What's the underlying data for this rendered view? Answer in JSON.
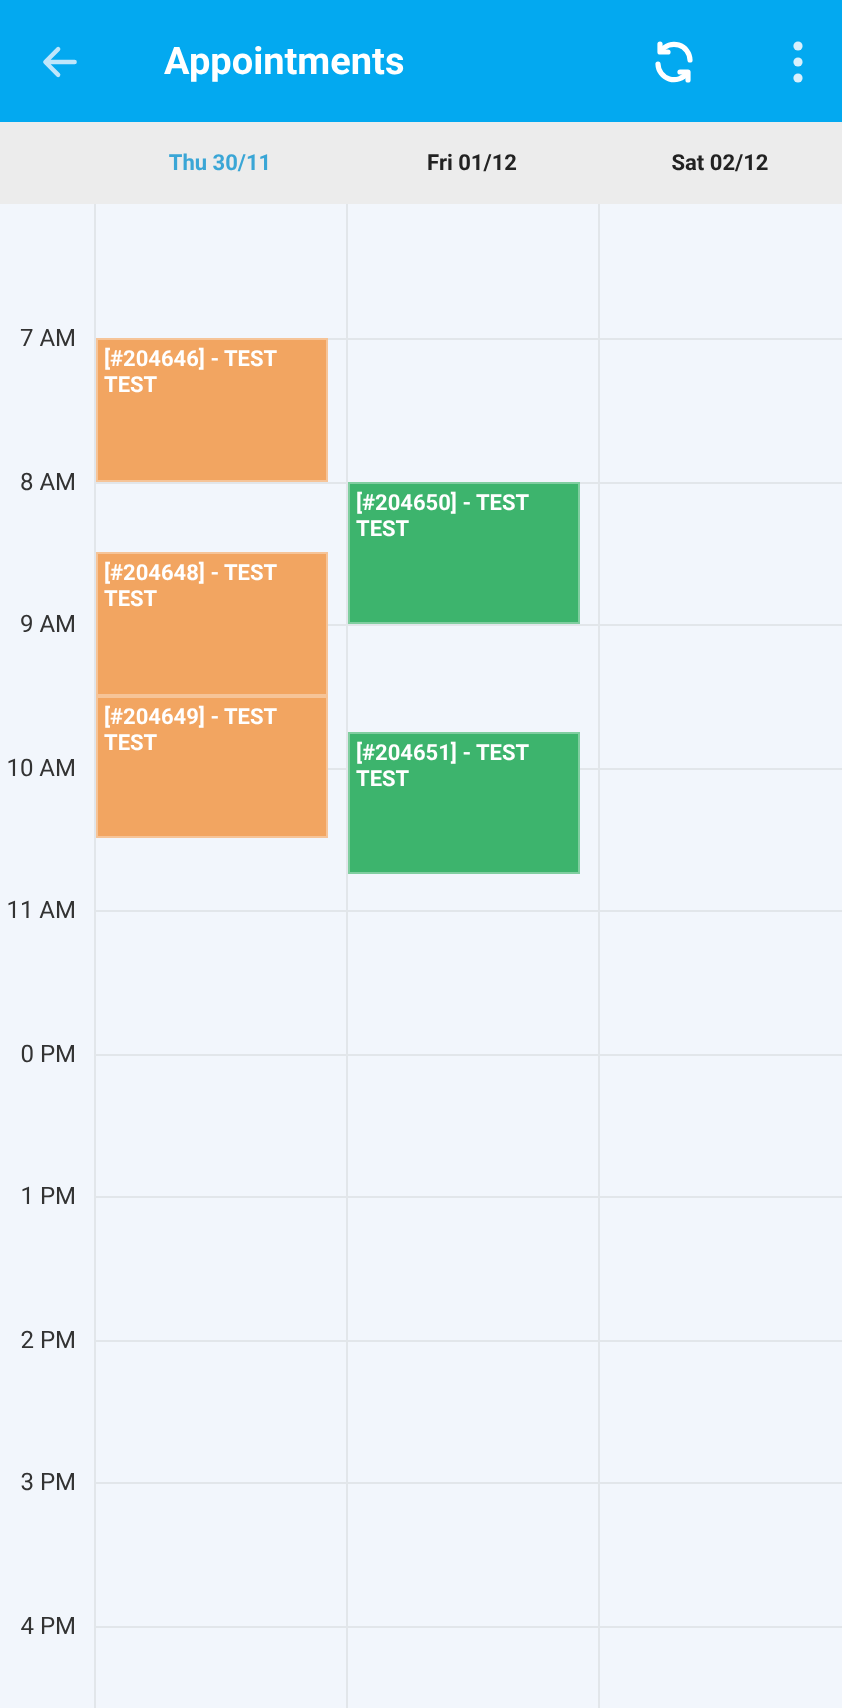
{
  "app_bar": {
    "title": "Appointments"
  },
  "days": [
    {
      "label": "Thu 30/11",
      "selected": true,
      "events": [
        {
          "title": "[#204646] - TEST TEST",
          "color": "#f2a561"
        },
        {
          "title": "[#204648] - TEST TEST",
          "color": "#f2a561"
        },
        {
          "title": "[#204649] - TEST TEST",
          "color": "#f2a561"
        }
      ]
    },
    {
      "label": "Fri 01/12",
      "selected": false,
      "events": [
        {
          "title": "[#204650] - TEST TEST",
          "color": "#3db46d"
        },
        {
          "title": "[#204651] - TEST TEST",
          "color": "#3db46d"
        }
      ]
    },
    {
      "label": "Sat 02/12",
      "selected": false
    }
  ],
  "hours": [
    "7 AM",
    "8 AM",
    "9 AM",
    "10 AM",
    "11 AM",
    "0 PM",
    "1 PM",
    "2 PM",
    "3 PM",
    "4 PM"
  ]
}
